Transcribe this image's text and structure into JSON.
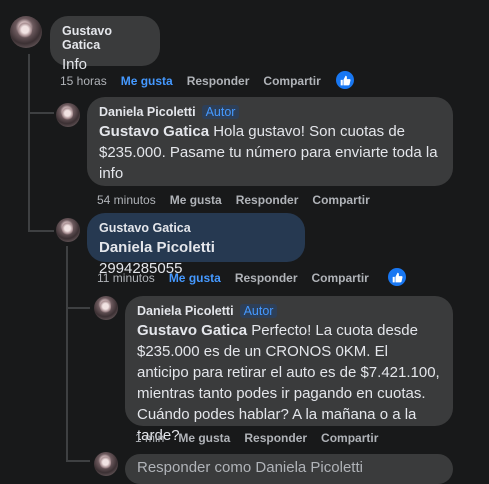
{
  "comments": [
    {
      "author": "Gustavo Gatica",
      "text": "Info",
      "time": "15 horas",
      "like_label": "Me gusta",
      "reply_label": "Responder",
      "share_label": "Compartir"
    },
    {
      "author": "Daniela Picoletti",
      "badge": "Autor",
      "mention": "Gustavo Gatica",
      "text": " Hola gustavo! Son cuotas de $235.000. Pasame tu número para enviarte toda la info",
      "time": "54 minutos",
      "like_label": "Me gusta",
      "reply_label": "Responder",
      "share_label": "Compartir"
    },
    {
      "author": "Gustavo Gatica",
      "mention": "Daniela Picoletti",
      "text": " 2994285055",
      "time": "11 minutos",
      "like_label": "Me gusta",
      "reply_label": "Responder",
      "share_label": "Compartir"
    },
    {
      "author": "Daniela Picoletti",
      "badge": "Autor",
      "mention": "Gustavo Gatica",
      "text": " Perfecto! La cuota desde $235.000 es de un CRONOS 0KM. El anticipo para retirar el auto es de $7.421.100, mientras tanto podes ir pagando en cuotas. Cuándo podes hablar? A la mañana o a la tarde?",
      "time": "1 min",
      "like_label": "Me gusta",
      "reply_label": "Responder",
      "share_label": "Compartir"
    }
  ],
  "reply_box": {
    "placeholder": "Responder como Daniela Picoletti"
  },
  "colors": {
    "background": "#18191a",
    "bubble": "#3a3b3c",
    "highlight_bubble": "#263951",
    "accent": "#4599ff",
    "like_blue": "#1877f2"
  },
  "icons": {
    "like_reaction": "thumbs-up-icon"
  }
}
